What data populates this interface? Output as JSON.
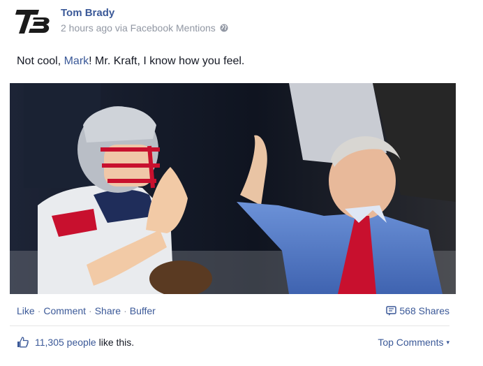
{
  "post": {
    "author": "Tom Brady",
    "time": "2 hours ago via Facebook Mentions",
    "status_before": "Not cool, ",
    "status_mention": "Mark",
    "status_after": "! Mr. Kraft, I know how you feel.",
    "avatar_icon": "tb12-logo-icon",
    "audience_icon": "globe-icon"
  },
  "photo": {
    "description_icon": "photo-icon"
  },
  "actions": {
    "like": "Like",
    "comment": "Comment",
    "share": "Share",
    "buffer": "Buffer",
    "separator": "·"
  },
  "shares": {
    "label": "568 Shares",
    "icon": "shares-icon"
  },
  "likes": {
    "count": "11,305 people",
    "suffix": " like this.",
    "icon": "thumbs-up-icon"
  },
  "comments": {
    "top_label": "Top Comments",
    "caret": "▾"
  },
  "colors": {
    "link": "#3b5998",
    "muted": "#9197a3",
    "text": "#141823"
  }
}
